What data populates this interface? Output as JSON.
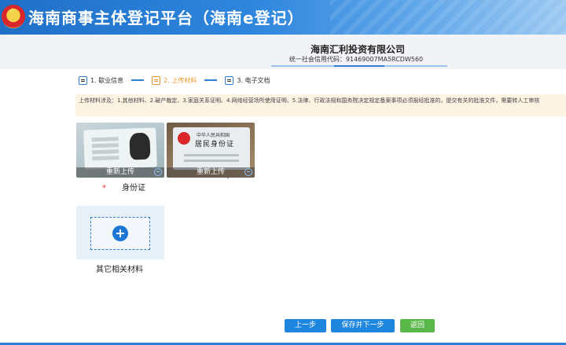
{
  "header": {
    "title": "海南商事主体登记平台（海南e登记）",
    "colors": {
      "start": "#1f6fc7",
      "end": "#9cc9f2"
    }
  },
  "company": {
    "name": "海南汇利投资有限公司",
    "credit_code": "统一社会信用代码：91469007MA5RCDW560"
  },
  "steps": [
    {
      "label": "1. 歇业信息",
      "icon": "form-icon",
      "active": false
    },
    {
      "label": "2. 上传材料",
      "icon": "upload-icon",
      "active": true
    },
    {
      "label": "3. 电子文档",
      "icon": "document-icon",
      "active": false
    }
  ],
  "notice": {
    "text": "上传材料涉及：1.其他材料、2.破产裁定、3.家庭关系证明、4.网络经营场所使用证明、5.法律、行政法规和国务院决定规定备案事项必须报经批准的，提交有关的批准文件，需要转人工审核"
  },
  "uploads": {
    "reupload_label": "重新上传",
    "id_card_label": "身份证",
    "required_mark": "*",
    "stray_mark": "`",
    "id_front_text": {
      "line1": "中华人民共和国",
      "line2": "居民身份证"
    }
  },
  "other_materials": {
    "label": "其它相关材料",
    "add_symbol": "+"
  },
  "buttons": {
    "prev": "上一步",
    "save_next": "保存并下一步",
    "back": "返回"
  },
  "colors": {
    "primary": "#1f86e0",
    "success": "#5ab84a",
    "active_step": "#f0962e",
    "notice_bg": "#fdf3e3"
  }
}
